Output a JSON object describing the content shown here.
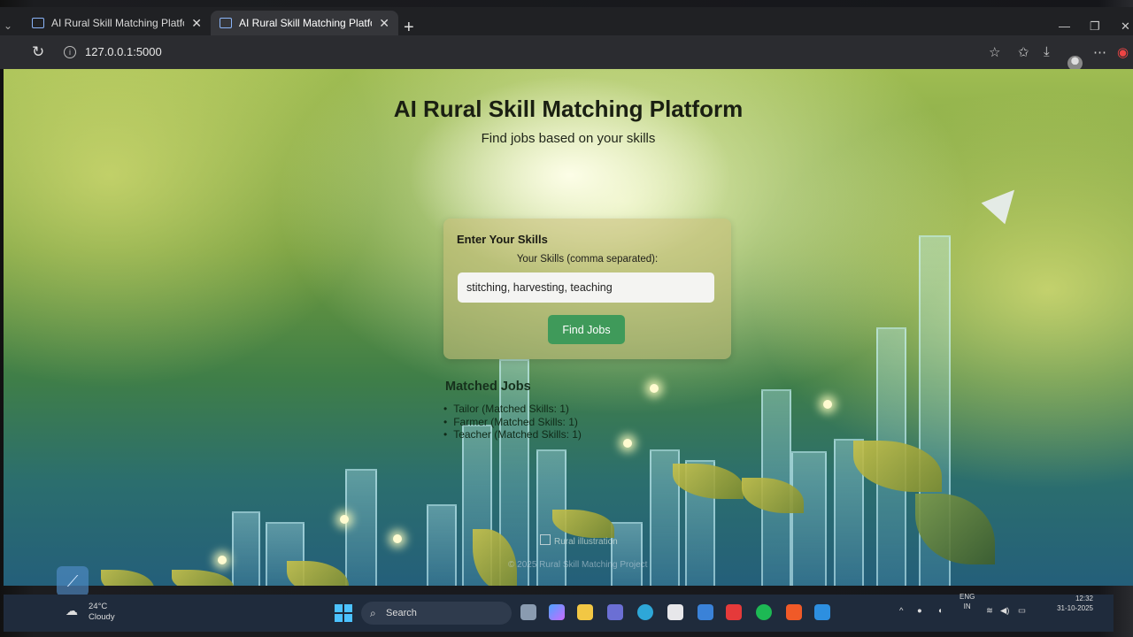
{
  "browser": {
    "tabs": [
      {
        "title": "AI Rural Skill Matching Platform",
        "active": false
      },
      {
        "title": "AI Rural Skill Matching Platform",
        "active": true
      }
    ],
    "url": "127.0.0.1:5000"
  },
  "page": {
    "title": "AI Rural Skill Matching Platform",
    "subtitle": "Find jobs based on your skills",
    "form": {
      "heading": "Enter Your Skills",
      "label": "Your Skills (comma separated):",
      "input_value": "stitching, harvesting, teaching",
      "button_label": "Find Jobs"
    },
    "results": {
      "heading": "Matched Jobs",
      "jobs": [
        "Tailor (Matched Skills: 1)",
        "Farmer (Matched Skills: 1)",
        "Teacher (Matched Skills: 1)"
      ]
    },
    "image_alt": "Rural illustration",
    "footer": "© 2025 Rural Skill Matching Project"
  },
  "taskbar": {
    "weather_temp": "24°C",
    "weather_desc": "Cloudy",
    "search_label": "Search",
    "language": "ENG",
    "region": "IN",
    "time": "12:32",
    "date": "31-10-2025"
  },
  "colors": {
    "button": "#3f9a5a",
    "taskbar": "#1f2b3c",
    "chrome": "#202124"
  }
}
